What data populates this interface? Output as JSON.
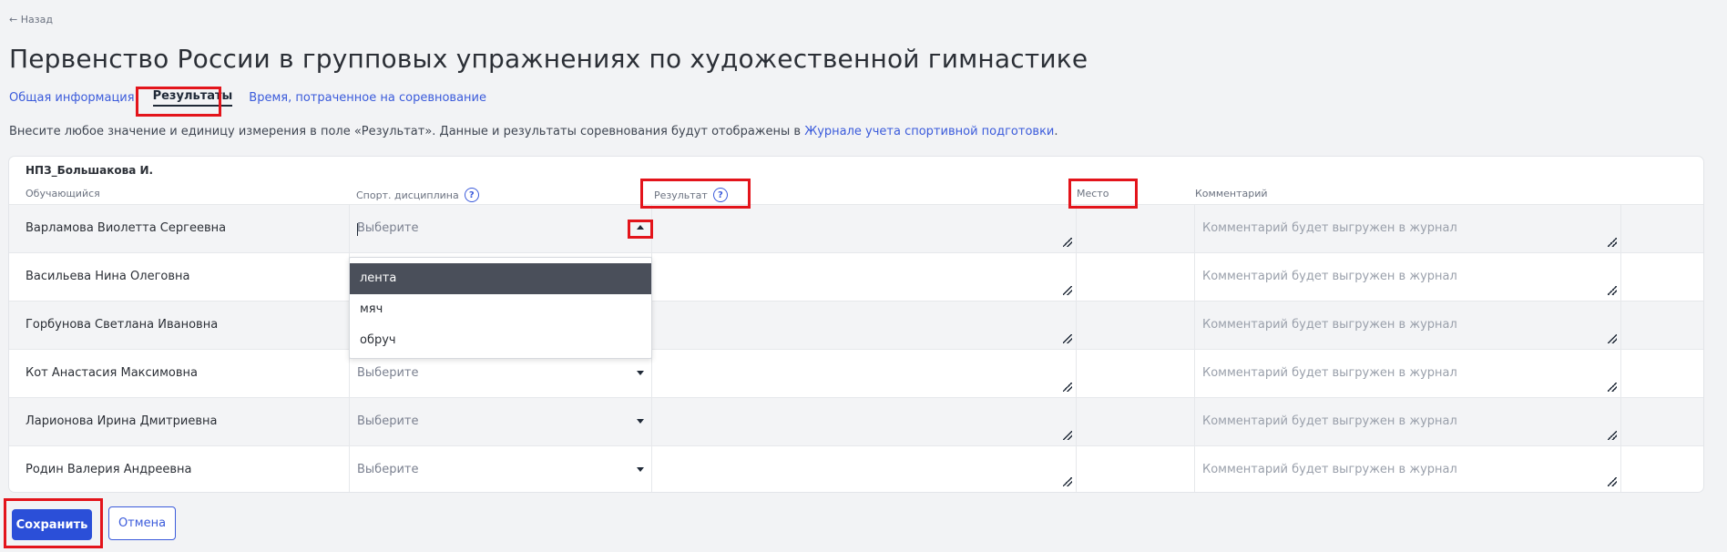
{
  "nav": {
    "back_label": "← Назад"
  },
  "page": {
    "title": "Первенство России в групповых упражнениях по художественной гимнастике"
  },
  "tabs": [
    {
      "label": "Общая информация",
      "active": false
    },
    {
      "label": "Результаты",
      "active": true
    },
    {
      "label": "Время, потраченное на соревнование",
      "active": false
    }
  ],
  "hint": {
    "text": "Внесите любое значение и единицу измерения в поле «Результат». Данные и результаты соревнования будут отображены в ",
    "link": "Журнале учета спортивной подготовки",
    "end": "."
  },
  "table": {
    "group_title": "НПЗ_Большакова И.",
    "columns": {
      "student": "Обучающийся",
      "discipline": "Спорт. дисциплина",
      "result": "Результат",
      "place": "Место",
      "comment": "Комментарий"
    },
    "select_placeholder": "Выберите",
    "comment_placeholder": "Комментарий будет выгружен в журнал",
    "rows": [
      {
        "name": "Варламова Виолетта Сергеевна"
      },
      {
        "name": "Васильева Нина Олеговна"
      },
      {
        "name": "Горбунова Светлана Ивановна"
      },
      {
        "name": "Кот Анастасия Максимовна"
      },
      {
        "name": "Ларионова Ирина Дмитриевна"
      },
      {
        "name": "Родин Валерия Андреевна"
      }
    ]
  },
  "dropdown": {
    "options": [
      "лента",
      "мяч",
      "обруч"
    ],
    "highlighted": "лента"
  },
  "actions": {
    "save_label": "Сохранить",
    "cancel_label": "Отмена"
  },
  "colors": {
    "accent": "#2b4fd8",
    "link": "#3b5bdb",
    "highlight": "#e3141b"
  },
  "icons": {
    "help": "question-circle-icon",
    "caret": "caret-down-icon",
    "resize": "resize-handle-icon"
  }
}
